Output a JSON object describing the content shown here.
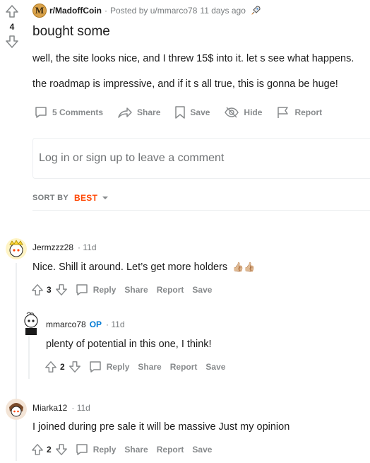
{
  "post": {
    "subreddit": "r/MadoffCoin",
    "subreddit_initial": "M",
    "posted_by": "Posted by u/mmarco78",
    "age": "11 days ago",
    "vote_count": "4",
    "title": "bought some",
    "body": [
      "well, the site looks nice, and I threw 15$ into it. let s see what happens.",
      "the roadmap is impressive, and if it s all true, this is gonna be huge!"
    ],
    "actions": {
      "comments": "5 Comments",
      "share": "Share",
      "save": "Save",
      "hide": "Hide",
      "report": "Report"
    }
  },
  "comment_box": {
    "placeholder": "Log in or sign up to leave a comment"
  },
  "sort": {
    "label": "SORT BY",
    "value": "BEST"
  },
  "comments": [
    {
      "user": "Jermzzz28",
      "op": "",
      "time": "11d",
      "text": "Nice. Shill it around. Let’s get more holders",
      "emoji": "👍🏼👍🏼",
      "score": "3",
      "reply": "Reply",
      "share": "Share",
      "report": "Report",
      "save": "Save"
    },
    {
      "user": "mmarco78",
      "op": "OP",
      "time": "11d",
      "text": "plenty of potential in this one, I think!",
      "score": "2",
      "reply": "Reply",
      "share": "Share",
      "report": "Report",
      "save": "Save"
    },
    {
      "user": "Miarka12",
      "op": "",
      "time": "11d",
      "text": "I joined during pre sale it will be massive Just my opinion",
      "score": "2",
      "reply": "Reply",
      "share": "Share",
      "report": "Report",
      "save": "Save"
    }
  ],
  "colors": {
    "accent": "#ff4500",
    "op": "#0079d3",
    "muted": "#878a8c",
    "border": "#edeff1"
  },
  "icons": [
    "upvote-icon",
    "downvote-icon",
    "comment-icon",
    "share-icon",
    "save-icon",
    "hide-icon",
    "report-icon",
    "rocket-icon",
    "chevron-down-icon"
  ]
}
